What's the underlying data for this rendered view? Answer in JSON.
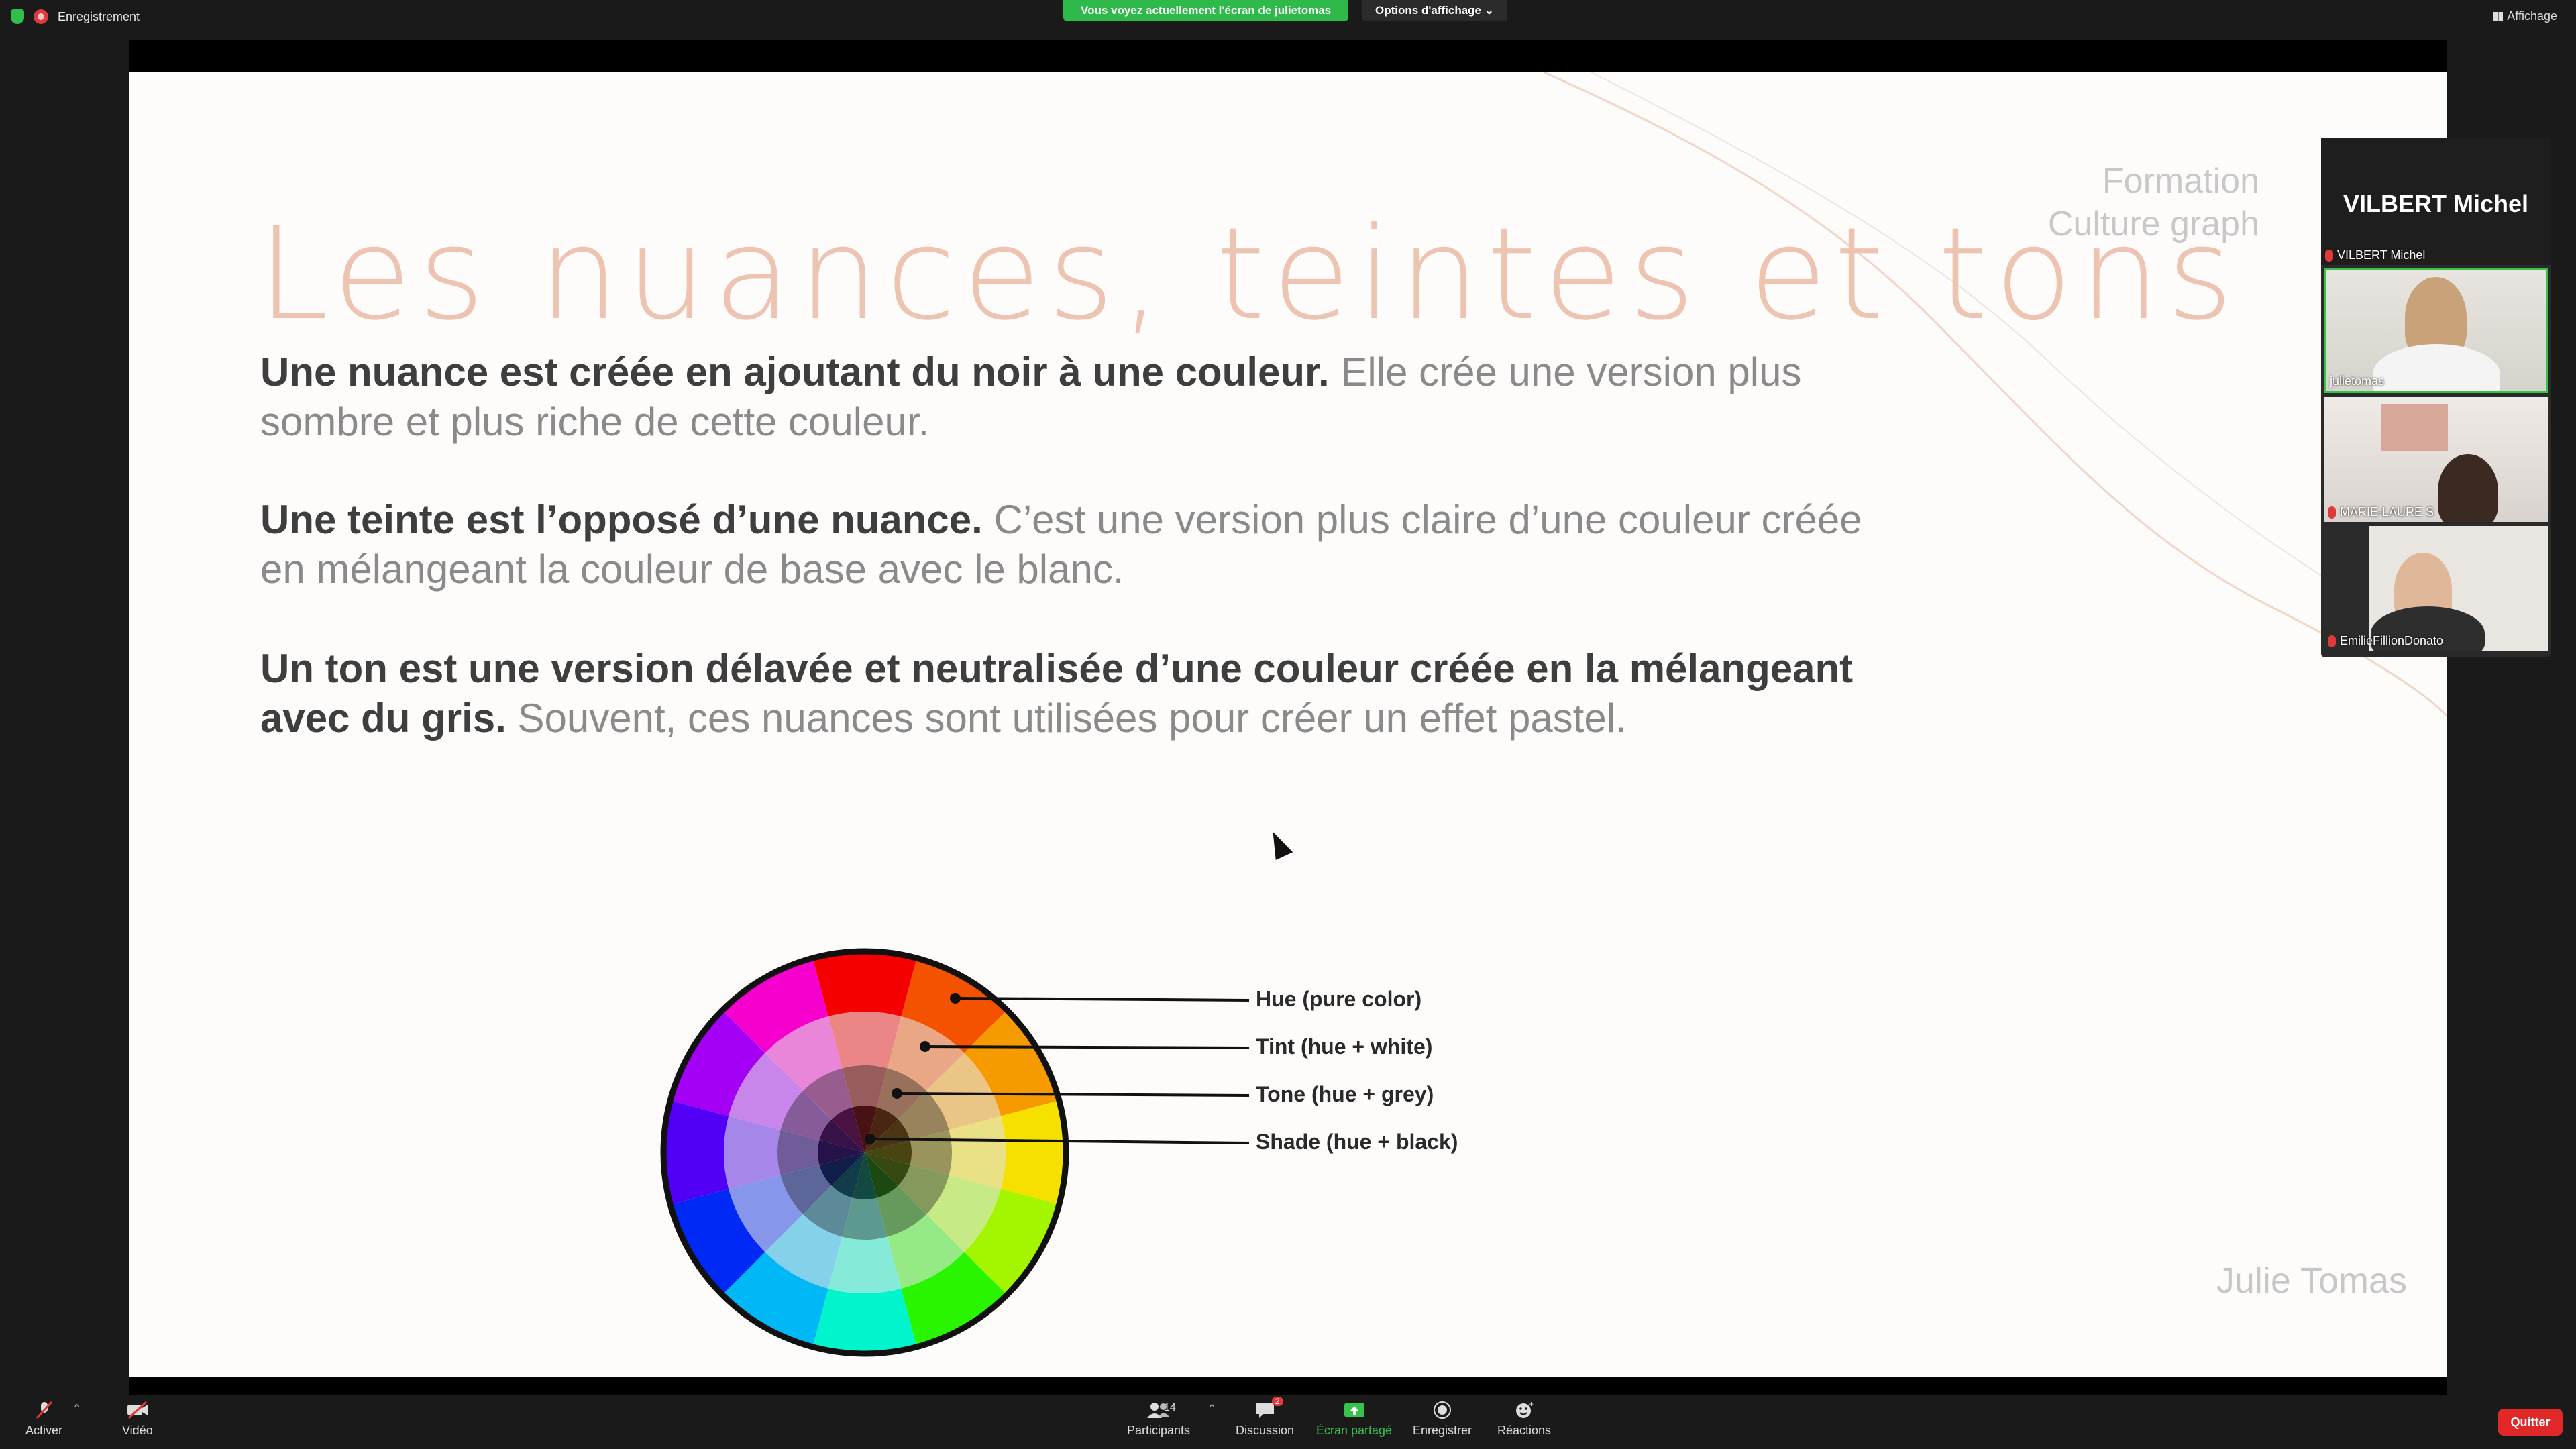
{
  "topbar": {
    "recording": "Enregistrement",
    "share_banner": "Vous voyez actuellement l'écran de julietomas",
    "view_options": "Options d'affichage ⌄",
    "display": "Affichage"
  },
  "slide": {
    "title": "Les nuances, teintes et tons",
    "formation_line1": "Formation",
    "formation_line2": "Culture graph",
    "p1_bold": "Une nuance est créée en ajoutant du noir à une couleur.",
    "p1_rest": " Elle crée une version plus sombre et plus riche de cette couleur.",
    "p2_bold": "Une teinte est l’opposé d’une nuance.",
    "p2_rest": " C’est une version plus claire d’une couleur créée en mélangeant la couleur de base avec le blanc.",
    "p3_bold": "Un ton est une version délavée et neutralisée d’une couleur créée en la mélangeant avec du gris.",
    "p3_rest": " Souvent, ces nuances sont utilisées pour créer un effet pastel.",
    "author": "Julie Tomas",
    "wheel_labels": [
      "Hue (pure color)",
      "Tint (hue + white)",
      "Tone (hue + grey)",
      "Shade (hue + black)"
    ]
  },
  "panel": {
    "host_name": "VILBERT Michel",
    "host_label": "VILBERT Michel",
    "tiles": [
      "julietomas",
      "MARIE-LAURE S",
      "EmilieFillionDonato"
    ]
  },
  "toolbar": {
    "mute": "Activer",
    "video": "Vidéo",
    "participants": "Participants",
    "participants_count": "14",
    "chat": "Discussion",
    "chat_badge": "2",
    "share": "Écran partagé",
    "record": "Enregistrer",
    "reactions": "Réactions",
    "quit": "Quitter"
  },
  "colors": {
    "accent_green": "#37c24c",
    "danger_red": "#e02828",
    "title_peach": "#ecc4b1"
  }
}
